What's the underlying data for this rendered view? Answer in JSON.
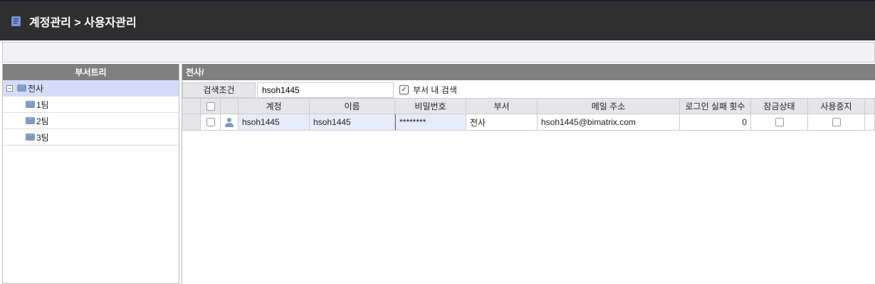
{
  "header": {
    "title": "계정관리 > 사용자관리"
  },
  "tree": {
    "title": "부서트리",
    "items": [
      {
        "label": "전사",
        "selected": true
      },
      {
        "label": "1팀"
      },
      {
        "label": "2팀"
      },
      {
        "label": "3팀"
      }
    ]
  },
  "main": {
    "path": "전사/",
    "search_label": "검색조건",
    "search_value": "hsoh1445",
    "in_dept_label": "부서 내 검색",
    "in_dept_checked": true
  },
  "grid": {
    "columns": [
      "계정",
      "이름",
      "비밀번호",
      "부서",
      "메일 주소",
      "로그인 실패 횟수",
      "잠금상태",
      "사용중지"
    ],
    "rows": [
      {
        "account": "hsoh1445",
        "name": "hsoh1445",
        "password": "********",
        "dept": "전사",
        "email": "hsoh1445@bimatrix.com",
        "fail_count": "0",
        "locked": false,
        "disabled": false
      }
    ]
  }
}
